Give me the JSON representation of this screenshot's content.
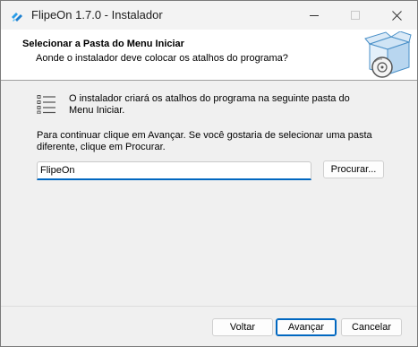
{
  "window": {
    "title": "FlipeOn 1.7.0 - Instalador",
    "controls": {
      "minimize_icon": "minimize-icon",
      "maximize_icon": "maximize-icon",
      "close_icon": "close-icon"
    }
  },
  "header": {
    "title": "Selecionar a Pasta do Menu Iniciar",
    "subtitle": "Aonde o instalador deve colocar os atalhos do programa?"
  },
  "body": {
    "info_text": "O instalador criará os atalhos do programa na seguinte pasta do Menu Iniciar.",
    "instruction_text": "Para continuar clique em Avançar. Se você gostaria de selecionar uma pasta diferente, clique em Procurar.",
    "folder_value": "FlipeOn",
    "browse_label": "Procurar..."
  },
  "footer": {
    "back_label": "Voltar",
    "next_label": "Avançar",
    "cancel_label": "Cancelar"
  },
  "colors": {
    "accent": "#0067c0",
    "app_icon": "#2a9de8"
  }
}
